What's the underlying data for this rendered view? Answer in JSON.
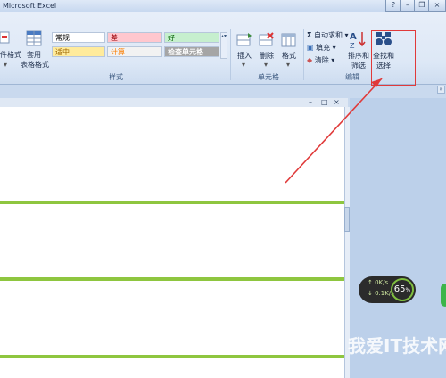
{
  "window": {
    "title": "Microsoft Excel"
  },
  "ribbon": {
    "styles_group": {
      "conditional_format_label": "件格式",
      "table_format_label1": "套用",
      "table_format_label2": "表格格式",
      "cells": [
        {
          "label": "常规",
          "bg": "#ffffff",
          "fg": "#000000"
        },
        {
          "label": "差",
          "bg": "#ffc7ce",
          "fg": "#9c0006"
        },
        {
          "label": "好",
          "bg": "#c6efce",
          "fg": "#006100"
        },
        {
          "label": "适中",
          "bg": "#ffeb9c",
          "fg": "#9c6500"
        },
        {
          "label": "计算",
          "bg": "#f2f2f2",
          "fg": "#fa7d00"
        },
        {
          "label": "检查单元格",
          "bg": "#a5a5a5",
          "fg": "#ffffff"
        }
      ],
      "group_label": "样式"
    },
    "cells_group": {
      "insert_label": "插入",
      "delete_label": "删除",
      "format_label": "格式",
      "group_label": "单元格"
    },
    "editing_group": {
      "autosum_label": "自动求和",
      "fill_label": "填充",
      "clear_label": "清除",
      "sort_label1": "排序和",
      "sort_label2": "筛选",
      "find_label1": "查找和",
      "find_label2": "选择",
      "group_label": "编辑"
    }
  },
  "speed_widget": {
    "up": "0K/s",
    "down": "0.1K/s",
    "percent": "65",
    "percent_unit": "%"
  },
  "watermark": "我爱IT技术网"
}
